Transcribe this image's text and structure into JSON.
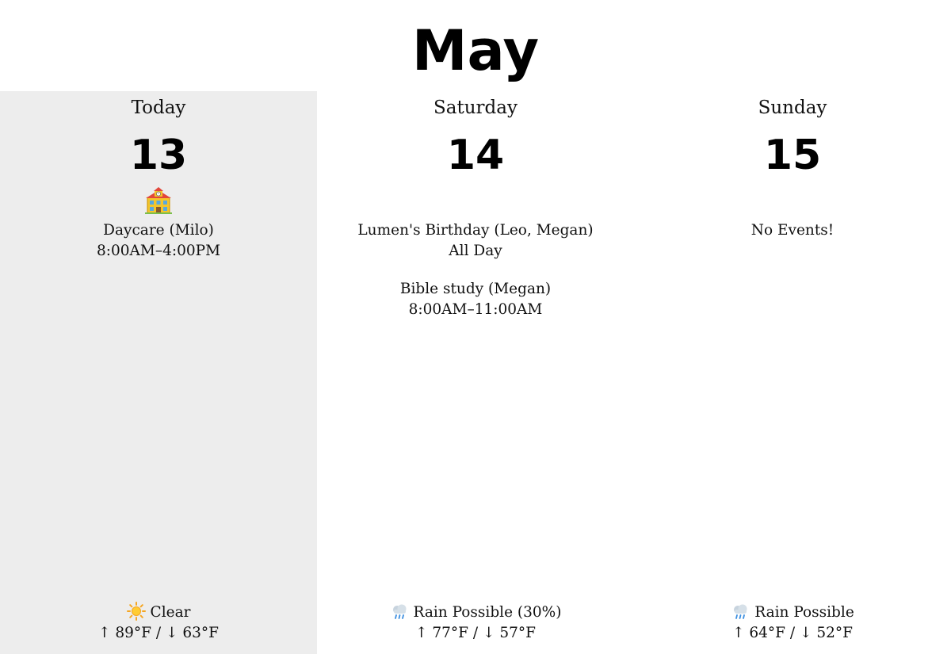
{
  "month": "May",
  "days": [
    {
      "label": "Today",
      "number": "13",
      "icon": "school-building-icon",
      "events": [
        {
          "title": "Daycare (Milo)",
          "time": "8:00AM–4:00PM"
        }
      ],
      "weather": {
        "icon": "sun-icon",
        "condition": "Clear",
        "temps": "↑ 89°F  / ↓ 63°F"
      }
    },
    {
      "label": "Saturday",
      "number": "14",
      "events": [
        {
          "title": "Lumen's Birthday (Leo, Megan)",
          "time": "All Day"
        },
        {
          "title": "Bible study (Megan)",
          "time": "8:00AM–11:00AM"
        }
      ],
      "weather": {
        "icon": "rain-cloud-icon",
        "condition": "Rain Possible (30%)",
        "temps": "↑ 77°F  / ↓ 57°F"
      }
    },
    {
      "label": "Sunday",
      "number": "15",
      "no_events": "No Events!",
      "weather": {
        "icon": "rain-cloud-icon",
        "condition": "Rain Possible",
        "temps": "↑ 64°F  / ↓ 52°F"
      }
    }
  ],
  "colors": {
    "today_background": "#ededed",
    "page_background": "#ffffff",
    "text": "#111111"
  }
}
